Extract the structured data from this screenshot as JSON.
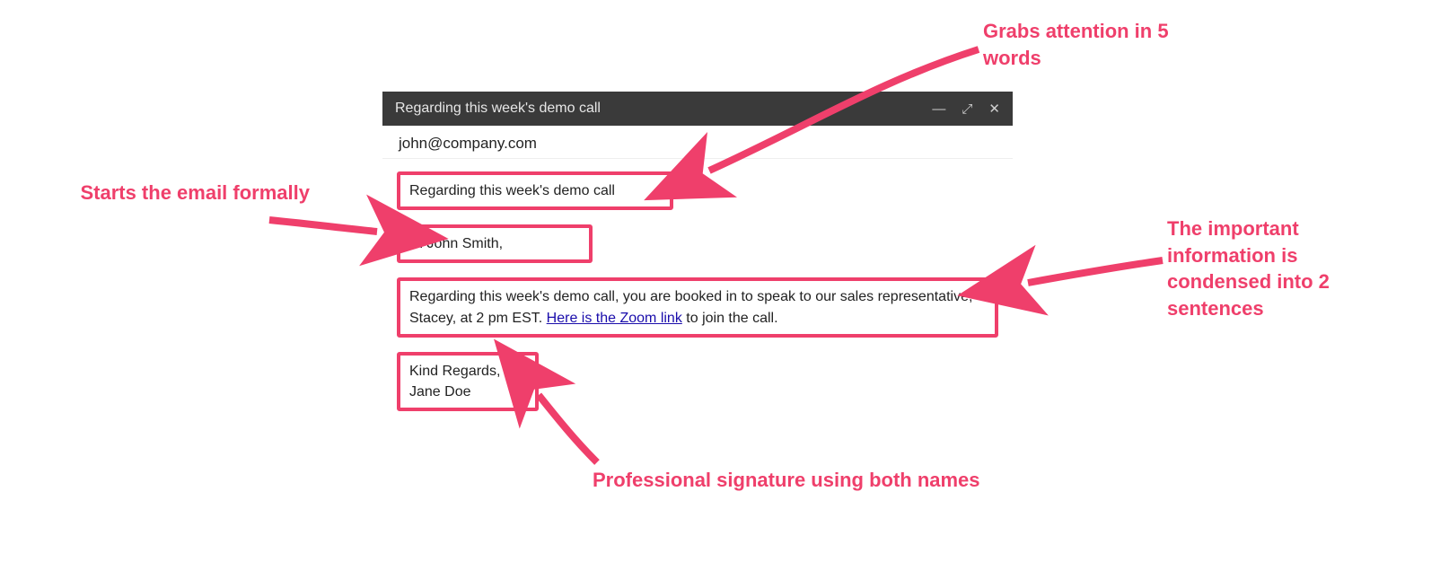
{
  "compose": {
    "titlebar": "Regarding this week's demo call",
    "to": "john@company.com",
    "subject": "Regarding this week's demo call",
    "greeting": "Hi John Smith,",
    "body_before_link": "Regarding this week's demo call, you are booked in to speak to our sales representative, Stacey, at 2 pm EST. ",
    "link_text": "Here is the Zoom link",
    "body_after_link": " to join the call.",
    "signoff": "Kind Regards,",
    "sender": "Jane Doe"
  },
  "annotations": {
    "attention": "Grabs attention in 5 words",
    "formal": "Starts the email formally",
    "condensed": "The important information is condensed into 2 sentences",
    "signature": "Professional signature using both names"
  },
  "colors": {
    "accent": "#ef3f6b",
    "titlebar": "#3a3a3a",
    "link": "#1a0dab"
  }
}
